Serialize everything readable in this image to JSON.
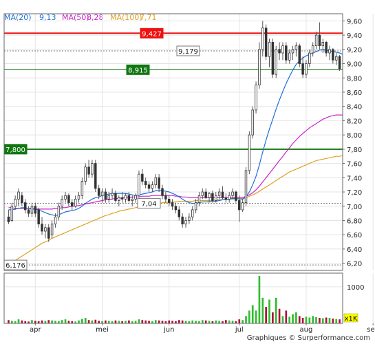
{
  "legend": {
    "ma20_label": "MA(20)",
    "ma20_value": "9,13",
    "ma50_label": "MA(50)",
    "ma50_value": "8,28",
    "ma100_label": "MA(100)",
    "ma100_value": "7,71"
  },
  "footer": "Graphiques © Surperformance.com",
  "volume_unit": "x1K",
  "colors": {
    "up": "#2eb82e",
    "down": "#b00000",
    "wick": "#555555",
    "ma20": "#1e6fd6",
    "ma50": "#cc22cc",
    "ma100": "#e0a020",
    "resistance": "#ee1111",
    "support": "#117711",
    "volume_up": "#2ebd2e",
    "volume_down": "#b0103a",
    "grid": "#e4e4e4"
  },
  "chart_data": {
    "type": "candlestick",
    "ylim": [
      6.1,
      9.7
    ],
    "y_ticks": [
      "6,20",
      "6,40",
      "6,60",
      "6,80",
      "7,00",
      "7,20",
      "7,40",
      "7,60",
      "7,80",
      "8,00",
      "8,20",
      "8,40",
      "8,60",
      "8,80",
      "9,00",
      "9,20",
      "9,40",
      "9,60"
    ],
    "x_labels": [
      "apr",
      "mei",
      "jun",
      "jul",
      "aug",
      "sep"
    ],
    "x_label_positions": [
      8,
      28,
      48,
      69,
      89,
      109
    ],
    "volume_ticks": [
      "1000"
    ],
    "volume_max": 1300,
    "levels": [
      {
        "name": "9,427",
        "value": 9.427,
        "kind": "resistance"
      },
      {
        "name": "8,915",
        "value": 8.915,
        "kind": "support"
      },
      {
        "name": "7,800",
        "value": 7.8,
        "kind": "support"
      },
      {
        "name": "9,179",
        "value": 9.179,
        "kind": "reference"
      },
      {
        "name": "7,04",
        "value": 7.04,
        "kind": "reference"
      },
      {
        "name": "6,176",
        "value": 6.176,
        "kind": "reference"
      }
    ],
    "ohlc": [
      [
        6.85,
        6.95,
        6.75,
        6.78
      ],
      [
        6.8,
        7.05,
        6.78,
        7.0
      ],
      [
        7.0,
        7.15,
        6.95,
        7.1
      ],
      [
        7.1,
        7.25,
        7.0,
        7.2
      ],
      [
        7.15,
        7.2,
        7.0,
        7.05
      ],
      [
        7.05,
        7.1,
        6.9,
        6.95
      ],
      [
        6.95,
        7.0,
        6.85,
        6.9
      ],
      [
        6.9,
        7.05,
        6.85,
        7.0
      ],
      [
        7.0,
        7.05,
        6.85,
        6.9
      ],
      [
        6.95,
        6.98,
        6.7,
        6.75
      ],
      [
        6.75,
        6.85,
        6.6,
        6.65
      ],
      [
        6.65,
        6.75,
        6.55,
        6.7
      ],
      [
        6.7,
        6.75,
        6.5,
        6.55
      ],
      [
        6.6,
        6.8,
        6.55,
        6.75
      ],
      [
        6.75,
        6.9,
        6.7,
        6.85
      ],
      [
        6.85,
        7.05,
        6.8,
        7.0
      ],
      [
        7.0,
        7.15,
        6.95,
        7.1
      ],
      [
        7.1,
        7.2,
        7.05,
        7.15
      ],
      [
        7.15,
        7.18,
        7.0,
        7.05
      ],
      [
        7.05,
        7.1,
        6.95,
        7.0
      ],
      [
        7.0,
        7.15,
        6.98,
        7.1
      ],
      [
        7.1,
        7.2,
        7.05,
        7.15
      ],
      [
        7.15,
        7.4,
        7.1,
        7.35
      ],
      [
        7.35,
        7.6,
        7.3,
        7.55
      ],
      [
        7.55,
        7.65,
        7.4,
        7.45
      ],
      [
        7.45,
        7.65,
        7.4,
        7.6
      ],
      [
        7.6,
        7.65,
        7.2,
        7.25
      ],
      [
        7.25,
        7.3,
        7.1,
        7.15
      ],
      [
        7.15,
        7.25,
        7.05,
        7.2
      ],
      [
        7.2,
        7.25,
        7.05,
        7.1
      ],
      [
        7.1,
        7.2,
        7.05,
        7.15
      ],
      [
        7.15,
        7.25,
        7.1,
        7.18
      ],
      [
        7.18,
        7.22,
        7.05,
        7.08
      ],
      [
        7.08,
        7.15,
        7.0,
        7.12
      ],
      [
        7.12,
        7.2,
        7.05,
        7.1
      ],
      [
        7.1,
        7.18,
        7.05,
        7.15
      ],
      [
        7.15,
        7.2,
        7.05,
        7.08
      ],
      [
        7.08,
        7.15,
        7.0,
        7.1
      ],
      [
        7.1,
        7.18,
        7.05,
        7.15
      ],
      [
        7.15,
        7.5,
        7.12,
        7.45
      ],
      [
        7.45,
        7.52,
        7.3,
        7.35
      ],
      [
        7.35,
        7.4,
        7.25,
        7.3
      ],
      [
        7.3,
        7.35,
        7.2,
        7.25
      ],
      [
        7.25,
        7.35,
        7.2,
        7.3
      ],
      [
        7.3,
        7.45,
        7.25,
        7.4
      ],
      [
        7.4,
        7.45,
        7.2,
        7.25
      ],
      [
        7.25,
        7.3,
        7.1,
        7.15
      ],
      [
        7.15,
        7.2,
        7.05,
        7.1
      ],
      [
        7.1,
        7.15,
        7.0,
        7.05
      ],
      [
        7.05,
        7.1,
        6.95,
        7.0
      ],
      [
        7.0,
        7.05,
        6.9,
        6.95
      ],
      [
        6.95,
        7.0,
        6.8,
        6.85
      ],
      [
        6.85,
        6.9,
        6.7,
        6.75
      ],
      [
        6.75,
        6.85,
        6.7,
        6.8
      ],
      [
        6.8,
        6.9,
        6.75,
        6.85
      ],
      [
        6.85,
        7.0,
        6.8,
        6.95
      ],
      [
        6.95,
        7.1,
        6.9,
        7.05
      ],
      [
        7.05,
        7.2,
        7.0,
        7.15
      ],
      [
        7.15,
        7.25,
        7.1,
        7.2
      ],
      [
        7.2,
        7.25,
        7.1,
        7.12
      ],
      [
        7.12,
        7.2,
        7.05,
        7.18
      ],
      [
        7.18,
        7.22,
        7.05,
        7.08
      ],
      [
        7.08,
        7.2,
        7.05,
        7.15
      ],
      [
        7.15,
        7.25,
        7.1,
        7.2
      ],
      [
        7.2,
        7.28,
        7.1,
        7.12
      ],
      [
        7.12,
        7.18,
        7.05,
        7.1
      ],
      [
        7.1,
        7.2,
        7.05,
        7.15
      ],
      [
        7.15,
        7.25,
        7.1,
        7.2
      ],
      [
        7.2,
        7.22,
        7.05,
        7.08
      ],
      [
        7.08,
        7.15,
        6.78,
        6.95
      ],
      [
        6.95,
        7.1,
        6.92,
        7.05
      ],
      [
        7.05,
        7.55,
        7.0,
        7.5
      ],
      [
        7.5,
        8.05,
        7.45,
        8.0
      ],
      [
        8.0,
        8.4,
        7.95,
        8.35
      ],
      [
        8.35,
        8.75,
        8.3,
        8.7
      ],
      [
        8.7,
        9.3,
        8.65,
        9.2
      ],
      [
        9.2,
        9.6,
        9.1,
        9.5
      ],
      [
        9.5,
        9.55,
        9.05,
        9.1
      ],
      [
        9.1,
        9.35,
        8.95,
        9.3
      ],
      [
        9.3,
        9.35,
        8.8,
        8.85
      ],
      [
        8.85,
        9.25,
        8.8,
        9.2
      ],
      [
        9.2,
        9.3,
        9.05,
        9.15
      ],
      [
        9.15,
        9.3,
        9.05,
        9.25
      ],
      [
        9.25,
        9.3,
        9.0,
        9.05
      ],
      [
        9.05,
        9.2,
        9.0,
        9.15
      ],
      [
        9.15,
        9.25,
        9.05,
        9.2
      ],
      [
        9.2,
        9.3,
        9.1,
        9.25
      ],
      [
        9.25,
        9.28,
        8.95,
        9.0
      ],
      [
        9.0,
        9.1,
        8.8,
        8.85
      ],
      [
        8.85,
        9.05,
        8.8,
        9.0
      ],
      [
        9.0,
        9.2,
        8.95,
        9.15
      ],
      [
        9.15,
        9.3,
        9.1,
        9.25
      ],
      [
        9.25,
        9.45,
        9.2,
        9.4
      ],
      [
        9.4,
        9.58,
        9.2,
        9.25
      ],
      [
        9.25,
        9.35,
        9.15,
        9.3
      ],
      [
        9.3,
        9.32,
        9.1,
        9.15
      ],
      [
        9.15,
        9.25,
        9.05,
        9.2
      ],
      [
        9.2,
        9.22,
        9.0,
        9.05
      ],
      [
        9.05,
        9.15,
        8.98,
        9.1
      ],
      [
        9.1,
        9.12,
        8.9,
        8.93
      ]
    ],
    "ma20": [
      6.95,
      6.95,
      6.96,
      6.97,
      6.98,
      6.98,
      6.97,
      6.96,
      6.96,
      6.95,
      6.93,
      6.91,
      6.89,
      6.88,
      6.87,
      6.88,
      6.9,
      6.92,
      6.93,
      6.94,
      6.95,
      6.97,
      7.0,
      7.04,
      7.07,
      7.1,
      7.12,
      7.13,
      7.15,
      7.16,
      7.17,
      7.18,
      7.18,
      7.18,
      7.18,
      7.18,
      7.17,
      7.16,
      7.15,
      7.16,
      7.17,
      7.18,
      7.19,
      7.2,
      7.22,
      7.22,
      7.22,
      7.21,
      7.2,
      7.18,
      7.16,
      7.13,
      7.1,
      7.07,
      7.05,
      7.04,
      7.04,
      7.05,
      7.06,
      7.06,
      7.06,
      7.07,
      7.07,
      7.08,
      7.09,
      7.09,
      7.1,
      7.11,
      7.11,
      7.1,
      7.1,
      7.13,
      7.2,
      7.3,
      7.42,
      7.58,
      7.76,
      7.93,
      8.08,
      8.22,
      8.36,
      8.49,
      8.61,
      8.72,
      8.82,
      8.91,
      8.99,
      9.04,
      9.08,
      9.11,
      9.13,
      9.15,
      9.17,
      9.19,
      9.2,
      9.19,
      9.18,
      9.17,
      9.16,
      9.15,
      9.13
    ],
    "ma50": [
      6.98,
      6.98,
      6.97,
      6.97,
      6.97,
      6.97,
      6.97,
      6.97,
      6.96,
      6.96,
      6.96,
      6.96,
      6.96,
      6.96,
      6.97,
      6.97,
      6.98,
      6.98,
      6.99,
      7.0,
      7.0,
      7.01,
      7.02,
      7.03,
      7.04,
      7.05,
      7.06,
      7.07,
      7.08,
      7.09,
      7.09,
      7.1,
      7.11,
      7.11,
      7.12,
      7.12,
      7.12,
      7.13,
      7.13,
      7.13,
      7.14,
      7.14,
      7.14,
      7.15,
      7.15,
      7.15,
      7.15,
      7.15,
      7.15,
      7.15,
      7.14,
      7.14,
      7.13,
      7.13,
      7.12,
      7.12,
      7.12,
      7.12,
      7.12,
      7.12,
      7.12,
      7.12,
      7.12,
      7.12,
      7.12,
      7.12,
      7.12,
      7.12,
      7.12,
      7.12,
      7.12,
      7.14,
      7.16,
      7.19,
      7.23,
      7.28,
      7.34,
      7.4,
      7.46,
      7.52,
      7.58,
      7.64,
      7.7,
      7.76,
      7.82,
      7.88,
      7.93,
      7.98,
      8.02,
      8.06,
      8.1,
      8.13,
      8.16,
      8.19,
      8.22,
      8.24,
      8.26,
      8.27,
      8.28,
      8.28,
      8.28
    ],
    "ma100": [
      6.18,
      6.21,
      6.24,
      6.27,
      6.3,
      6.33,
      6.36,
      6.39,
      6.42,
      6.45,
      6.48,
      6.5,
      6.52,
      6.55,
      6.57,
      6.59,
      6.61,
      6.63,
      6.65,
      6.67,
      6.69,
      6.71,
      6.73,
      6.75,
      6.77,
      6.79,
      6.81,
      6.83,
      6.85,
      6.87,
      6.88,
      6.9,
      6.91,
      6.93,
      6.94,
      6.95,
      6.96,
      6.97,
      6.98,
      6.99,
      7.0,
      7.01,
      7.02,
      7.03,
      7.04,
      7.04,
      7.05,
      7.05,
      7.06,
      7.06,
      7.06,
      7.07,
      7.07,
      7.07,
      7.07,
      7.07,
      7.08,
      7.08,
      7.08,
      7.08,
      7.08,
      7.08,
      7.09,
      7.09,
      7.09,
      7.09,
      7.1,
      7.1,
      7.1,
      7.11,
      7.11,
      7.12,
      7.14,
      7.16,
      7.18,
      7.21,
      7.24,
      7.27,
      7.3,
      7.33,
      7.36,
      7.39,
      7.42,
      7.45,
      7.48,
      7.5,
      7.52,
      7.54,
      7.56,
      7.58,
      7.6,
      7.62,
      7.64,
      7.65,
      7.66,
      7.67,
      7.68,
      7.69,
      7.7,
      7.7,
      7.71
    ],
    "volume": [
      90,
      70,
      60,
      110,
      80,
      60,
      50,
      90,
      70,
      60,
      80,
      70,
      90,
      80,
      70,
      60,
      90,
      110,
      70,
      60,
      50,
      80,
      120,
      150,
      90,
      80,
      100,
      70,
      60,
      80,
      70,
      60,
      80,
      70,
      60,
      70,
      80,
      60,
      70,
      110,
      90,
      80,
      70,
      60,
      90,
      80,
      70,
      60,
      80,
      70,
      60,
      90,
      80,
      70,
      60,
      80,
      70,
      60,
      90,
      80,
      70,
      60,
      80,
      70,
      60,
      90,
      80,
      70,
      60,
      110,
      90,
      200,
      350,
      500,
      350,
      1300,
      700,
      450,
      650,
      300,
      700,
      400,
      200,
      350,
      180,
      250,
      300,
      200,
      150,
      180,
      160,
      200,
      170,
      150,
      140,
      160,
      150,
      130,
      120,
      110
    ]
  }
}
